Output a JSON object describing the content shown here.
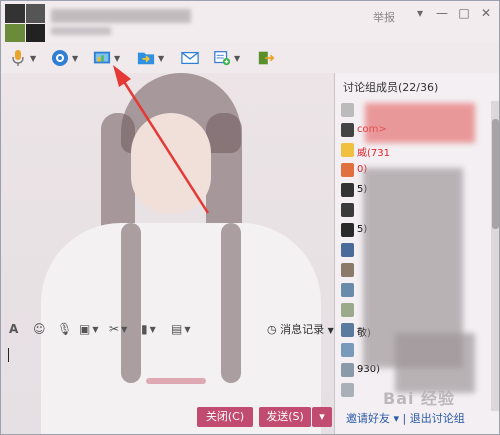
{
  "title": {
    "report_label": "举报"
  },
  "window_controls": {
    "minimize": "—",
    "maximize": "□",
    "close": "✕"
  },
  "toolbar_icons": [
    "microphone-icon",
    "video-icon",
    "screen-share-icon",
    "folder-icon",
    "mail-icon",
    "app-add-icon",
    "exit-icon"
  ],
  "members": {
    "title": "讨论组成员(22/36)",
    "rows": [
      {
        "text": "",
        "color": "#333333"
      },
      {
        "text": "                                    com>",
        "color": "#e0242a"
      },
      {
        "text": "威(731",
        "color": "#e0242a"
      },
      {
        "text": "                       0)",
        "color": "#e0242a"
      },
      {
        "text": "5)",
        "color": "#333333"
      },
      {
        "text": "",
        "color": "#333333"
      },
      {
        "text": "5)",
        "color": "#333333"
      },
      {
        "text": "",
        "color": "#333333"
      },
      {
        "text": "",
        "color": "#333333"
      },
      {
        "text": "",
        "color": "#333333"
      },
      {
        "text": "",
        "color": "#333333"
      },
      {
        "text": "敬)",
        "color": "#333333"
      },
      {
        "text": "",
        "color": "#333333"
      },
      {
        "text": "930)",
        "color": "#333333"
      },
      {
        "text": "",
        "color": "#333333"
      }
    ],
    "invite_label": "邀请好友 ▾ | 退出讨论组"
  },
  "input_toolbar": {
    "font_label": "A",
    "history_label": "消息记录"
  },
  "buttons": {
    "close_label": "关闭(C)",
    "send_label": "发送(S)",
    "send_arrow": "▾"
  },
  "watermark": "Bai 经验",
  "colors": {
    "accent": "#c24b72",
    "alert": "#e0242a",
    "arrow": "#e53935"
  }
}
